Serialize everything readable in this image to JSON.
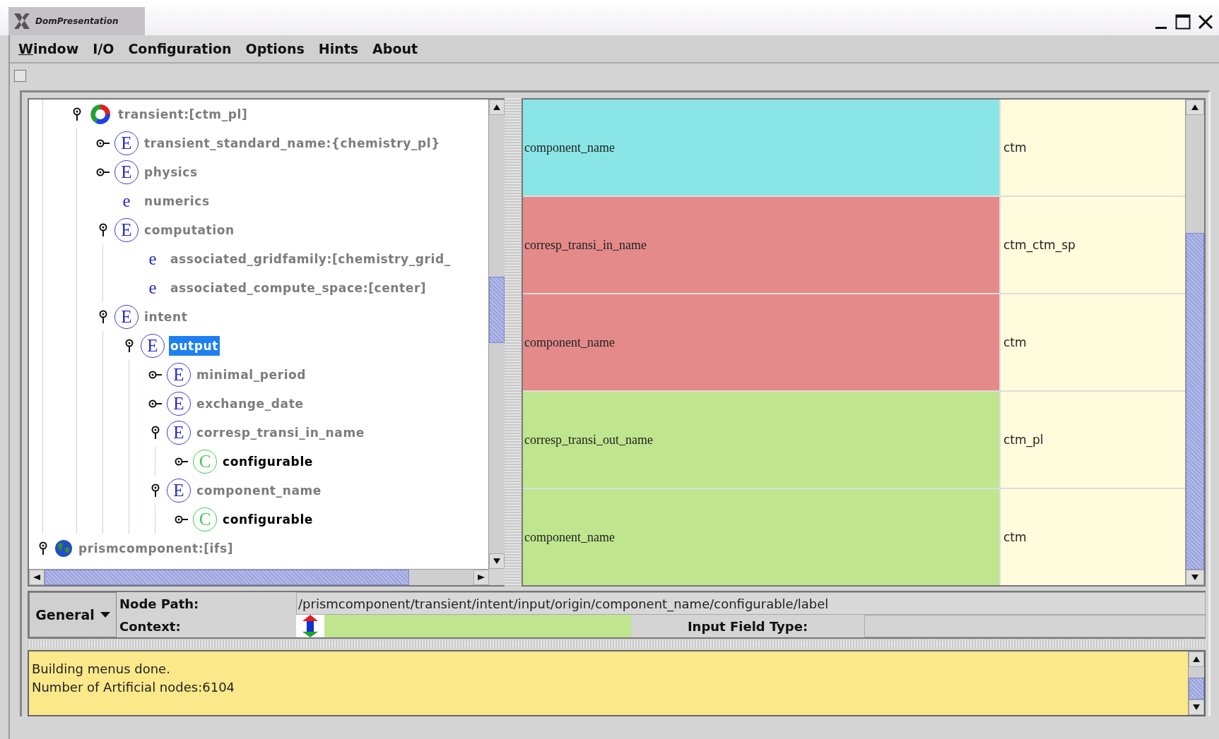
{
  "window": {
    "title": "DomPresentation"
  },
  "menu": [
    {
      "label": "Window",
      "mnemonic_underlined": true
    },
    {
      "label": "I/O",
      "mnemonic_underlined": false
    },
    {
      "label": "Configuration",
      "mnemonic_underlined": false
    },
    {
      "label": "Options",
      "mnemonic_underlined": false
    },
    {
      "label": "Hints",
      "mnemonic_underlined": false
    },
    {
      "label": "About",
      "mnemonic_underlined": false
    }
  ],
  "toolbar": {
    "checkbox": {
      "checked": false
    }
  },
  "tree": [
    {
      "label": "transient:[ctm_pl]",
      "kind": "ring",
      "expanded": true,
      "selected": false,
      "indented": true,
      "children": [
        {
          "label": "transient_standard_name:{chemistry_pl}",
          "kind": "element",
          "badge": "E",
          "expanded": false,
          "selected": false
        },
        {
          "label": "physics",
          "kind": "element",
          "badge": "E",
          "expanded": false,
          "selected": false
        },
        {
          "label": "numerics",
          "kind": "attribute",
          "badge": "e",
          "selected": false
        },
        {
          "label": "computation",
          "kind": "element",
          "badge": "E",
          "expanded": true,
          "selected": false,
          "children": [
            {
              "label": "associated_gridfamily:[chemistry_grid_",
              "kind": "attribute",
              "badge": "e",
              "selected": false
            },
            {
              "label": "associated_compute_space:[center]",
              "kind": "attribute",
              "badge": "e",
              "selected": false
            }
          ]
        },
        {
          "label": "intent",
          "kind": "element",
          "badge": "E",
          "expanded": true,
          "selected": false,
          "children": [
            {
              "label": "output",
              "kind": "element",
              "badge": "E",
              "expanded": true,
              "selected": true,
              "children": [
                {
                  "label": "minimal_period",
                  "kind": "element",
                  "badge": "E",
                  "expanded": false,
                  "selected": false
                },
                {
                  "label": "exchange_date",
                  "kind": "element",
                  "badge": "E",
                  "expanded": false,
                  "selected": false
                },
                {
                  "label": "corresp_transi_in_name",
                  "kind": "element",
                  "badge": "E",
                  "expanded": true,
                  "selected": false,
                  "children": [
                    {
                      "label": "configurable",
                      "kind": "configurable",
                      "badge": "C",
                      "expanded": false,
                      "selected": false
                    }
                  ]
                },
                {
                  "label": "component_name",
                  "kind": "element",
                  "badge": "E",
                  "expanded": true,
                  "selected": false,
                  "children": [
                    {
                      "label": "configurable",
                      "kind": "configurable",
                      "badge": "C",
                      "expanded": false,
                      "selected": false
                    }
                  ]
                }
              ]
            }
          ]
        }
      ]
    },
    {
      "label": "prismcomponent:[ifs]",
      "kind": "globe",
      "expanded": true,
      "selected": false,
      "indented": false
    }
  ],
  "table": {
    "rows": [
      {
        "name": "component_name",
        "value": "ctm",
        "color": "#8ae6e6"
      },
      {
        "name": "corresp_transi_in_name",
        "value": "ctm_ctm_sp",
        "color": "#e48a8a"
      },
      {
        "name": "component_name",
        "value": "ctm",
        "color": "#e48a8a"
      },
      {
        "name": "corresp_transi_out_name",
        "value": "ctm_pl",
        "color": "#bfe68e"
      },
      {
        "name": "component_name",
        "value": "ctm",
        "color": "#bfe68e"
      }
    ]
  },
  "info": {
    "dropdown": "General",
    "node_path_label": "Node Path:",
    "context_label": "Context:",
    "node_path": "/prismcomponent/transient/intent/input/origin/component_name/configurable/label",
    "input_field_type_label": "Input Field Type:"
  },
  "log": {
    "lines": [
      "Building menus done.",
      "Number of Artificial nodes:6104"
    ]
  }
}
